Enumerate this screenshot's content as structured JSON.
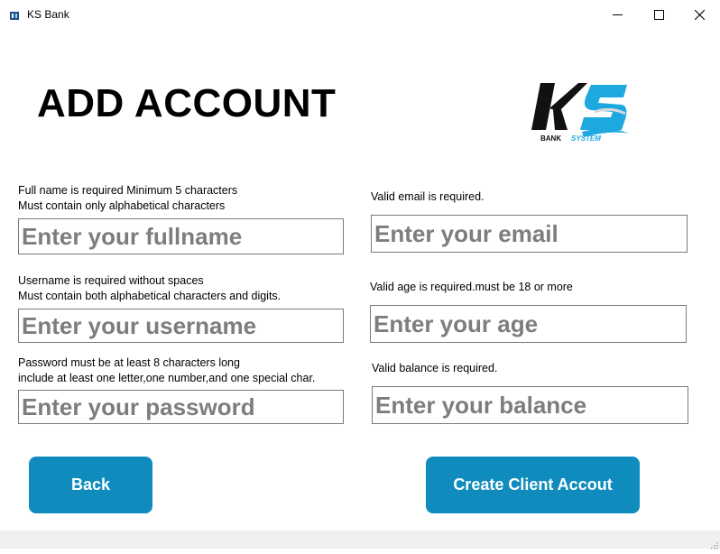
{
  "window": {
    "title": "KS Bank",
    "icons": {
      "app": "bank-app-icon",
      "minimize": "minimize-icon",
      "maximize": "maximize-icon",
      "close": "close-icon"
    }
  },
  "page": {
    "heading": "ADD ACCOUNT"
  },
  "logo": {
    "top_text": "KS",
    "left_sub": "BANK",
    "right_sub": "SYSTEM",
    "colors": {
      "dark": "#111111",
      "accent": "#1ea8e0"
    }
  },
  "fields": {
    "fullname": {
      "hint_line1": "Full name is required Minimum 5 characters",
      "hint_line2": "Must contain only alphabetical characters",
      "placeholder": "Enter your fullname"
    },
    "username": {
      "hint_line1": "Username is required without spaces",
      "hint_line2": "Must contain both alphabetical characters and digits.",
      "placeholder": "Enter your username"
    },
    "password": {
      "hint_line1": "Password must be at least 8 characters long",
      "hint_line2": "include at least one letter,one number,and one special char.",
      "placeholder": "Enter your password"
    },
    "email": {
      "hint_line1": "Valid email is required.",
      "placeholder": "Enter your email"
    },
    "age": {
      "hint_line1": "Valid age is required.must be 18 or more",
      "placeholder": "Enter your age"
    },
    "balance": {
      "hint_line1": "Valid balance is required.",
      "placeholder": "Enter your balance"
    }
  },
  "buttons": {
    "back": "Back",
    "create": "Create Client Accout"
  },
  "colors": {
    "button": "#0f8cbd",
    "placeholder": "#7d7d7d"
  }
}
